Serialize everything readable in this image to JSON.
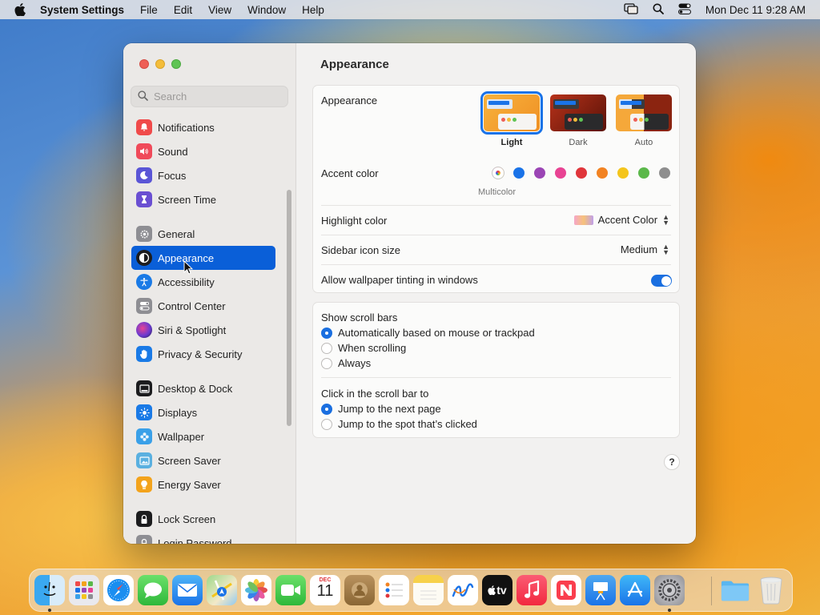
{
  "menubar": {
    "app_name": "System Settings",
    "items": [
      "File",
      "Edit",
      "View",
      "Window",
      "Help"
    ],
    "clock": "Mon Dec 11  9:28 AM"
  },
  "sidebar": {
    "search_placeholder": "Search",
    "items": [
      {
        "label": "Notifications",
        "icon": "bell-icon",
        "color": "#f04a4a"
      },
      {
        "label": "Sound",
        "icon": "speaker-icon",
        "color": "#f04a5a"
      },
      {
        "label": "Focus",
        "icon": "moon-icon",
        "color": "#5a55d6"
      },
      {
        "label": "Screen Time",
        "icon": "hourglass-icon",
        "color": "#6a4fd2"
      },
      {
        "label": "General",
        "icon": "gear-icon",
        "color": "#8e8e93"
      },
      {
        "label": "Appearance",
        "icon": "appearance-icon",
        "color": "#1c1c1e"
      },
      {
        "label": "Accessibility",
        "icon": "accessibility-icon",
        "color": "#1a7ae6"
      },
      {
        "label": "Control Center",
        "icon": "control-center-icon",
        "color": "#8e8e93"
      },
      {
        "label": "Siri & Spotlight",
        "icon": "siri-icon",
        "color": "#b03ad0"
      },
      {
        "label": "Privacy & Security",
        "icon": "hand-icon",
        "color": "#1a7ae6"
      },
      {
        "label": "Desktop & Dock",
        "icon": "dock-icon",
        "color": "#1c1c1e"
      },
      {
        "label": "Displays",
        "icon": "sun-icon",
        "color": "#1a7ae6"
      },
      {
        "label": "Wallpaper",
        "icon": "flower-icon",
        "color": "#3aa0e8"
      },
      {
        "label": "Screen Saver",
        "icon": "screensaver-icon",
        "color": "#5ab0e0"
      },
      {
        "label": "Energy Saver",
        "icon": "battery-icon",
        "color": "#f3a31c"
      },
      {
        "label": "Lock Screen",
        "icon": "lock-icon",
        "color": "#1c1c1e"
      },
      {
        "label": "Login Password",
        "icon": "lock-icon",
        "color": "#8e8e93"
      }
    ],
    "selected": "Appearance"
  },
  "content": {
    "title": "Appearance",
    "appearance": {
      "label": "Appearance",
      "options": [
        "Light",
        "Dark",
        "Auto"
      ],
      "selected": "Light"
    },
    "accent": {
      "label": "Accent color",
      "caption": "Multicolor",
      "colors": [
        "multicolor",
        "#1a73e8",
        "#9b45b5",
        "#e84393",
        "#e0363b",
        "#f28322",
        "#f4c51c",
        "#5bb84a",
        "#8e8e8e"
      ]
    },
    "highlight": {
      "label": "Highlight color",
      "value": "Accent Color"
    },
    "icon_size": {
      "label": "Sidebar icon size",
      "value": "Medium"
    },
    "tinting": {
      "label": "Allow wallpaper tinting in windows",
      "on": true
    },
    "scroll_bars": {
      "label": "Show scroll bars",
      "options": [
        "Automatically based on mouse or trackpad",
        "When scrolling",
        "Always"
      ],
      "selected": 0
    },
    "click_scroll": {
      "label": "Click in the scroll bar to",
      "options": [
        "Jump to the next page",
        "Jump to the spot that’s clicked"
      ],
      "selected": 0
    },
    "help": "?"
  },
  "dock": {
    "apps": [
      "finder-icon",
      "launchpad-icon",
      "safari-icon",
      "messages-icon",
      "mail-icon",
      "maps-icon",
      "photos-icon",
      "facetime-icon",
      "calendar-icon",
      "contacts-icon",
      "reminders-icon",
      "notes-icon",
      "freeform-icon",
      "tv-icon",
      "music-icon",
      "news-icon",
      "keynote-icon",
      "app-store-icon",
      "system-settings-icon",
      "folder-icon",
      "trash-icon"
    ],
    "calendar_month": "DEC",
    "calendar_day": "11",
    "tv_label": "tv"
  }
}
